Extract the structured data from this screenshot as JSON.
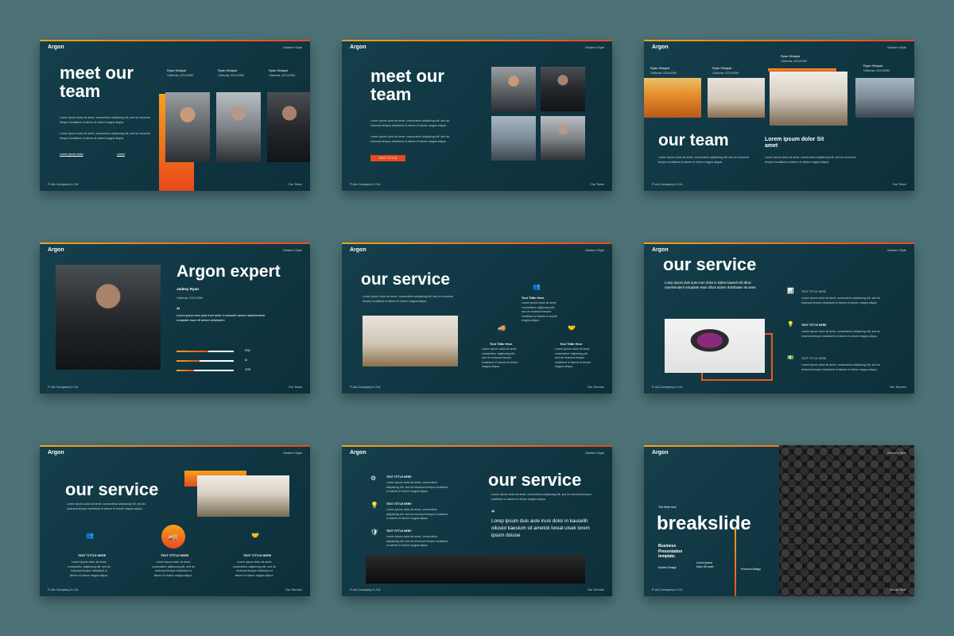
{
  "brand": "Argon",
  "style_label": "Modern Style",
  "footer_left": "P-AA Company in CA",
  "lorem": "Lorem ipsum dolor sit amet, consectetur adipiscing elit, sed do eiusmod tempor incididunt ut labore et dolore magna aliqua.",
  "slide1": {
    "title": "meet our team",
    "members": [
      {
        "name": "Ryan Hidayat",
        "meta": "California, 02/14/1990"
      },
      {
        "name": "Ryan Hidayat",
        "meta": "California, 02/14/1990"
      },
      {
        "name": "Ryan Hidayat",
        "meta": "California, 02/14/1990"
      }
    ],
    "footer_right": "Our Team",
    "link_left": "Lorem ipsum dolor",
    "link_right": "Lorem"
  },
  "slide2": {
    "title": "meet our team",
    "button": "TEXT TITTLE",
    "footer_right": "Our Team"
  },
  "slide3": {
    "title": "our team",
    "subtitle": "Lorem ipsum dolor Sit amet",
    "members": [
      {
        "name": "Ryan Hidayat",
        "meta": "California, 02/14/1990"
      },
      {
        "name": "Ryan Hidayat",
        "meta": "California, 02/14/1990"
      },
      {
        "name": "Ryan Hidayat",
        "meta": "California, 02/14/1990"
      },
      {
        "name": "Ryan Hidayat",
        "meta": "California, 02/14/1990"
      }
    ],
    "footer_right": "Our Team"
  },
  "slide4": {
    "title": "Argon expert",
    "name": "Jadesy Ryan",
    "meta": "California, 02/14/1990",
    "quote": "Lorem ipsum duis aute irure dolor in kausekh ailusci reprehenderit voluptate esse cill dolore dolorbaten",
    "skills": [
      {
        "label": "PSD",
        "value": 0.55
      },
      {
        "label": "AI",
        "value": 0.4
      },
      {
        "label": "CDR",
        "value": 0.3
      }
    ],
    "footer_right": "Our Team"
  },
  "slide5": {
    "title": "our service",
    "items": [
      {
        "label": "Text Tittle Here",
        "icon": "people-icon"
      },
      {
        "label": "Text Tittle Here",
        "icon": "truck-icon"
      },
      {
        "label": "Text Tittle Here",
        "icon": "handshake-icon"
      }
    ],
    "footer_right": "Our Service"
  },
  "slide6": {
    "title": "our service",
    "intro": "Lorep ipsum duis aute irure dolor in kalins kausell oili ollusi reprehenderit voluptate esse cillum dolore dolorbaten sit amet.",
    "items": [
      {
        "label": "TEXT TITTLE HERE",
        "icon": "chart-icon"
      },
      {
        "label": "TEXT TITTLE HERE",
        "icon": "bulb-icon"
      },
      {
        "label": "TEXT TITTLE HERE",
        "icon": "money-icon"
      }
    ],
    "footer_right": "Our Service"
  },
  "slide7": {
    "title": "our service",
    "items": [
      {
        "label": "TEXT TITTLE HERE",
        "icon": "people-icon"
      },
      {
        "label": "TEXT TITTLE HERE",
        "icon": "truck-icon"
      },
      {
        "label": "TEXT TITTLE HERE",
        "icon": "handshake-icon"
      }
    ],
    "footer_right": "Our Service"
  },
  "slide8": {
    "title": "our service",
    "items": [
      {
        "label": "TEXT TITTLE HERE",
        "icon": "gear-icon"
      },
      {
        "label": "TEXT TITTLE HERE",
        "icon": "bulb-icon"
      },
      {
        "label": "TEXT TITTLE HERE",
        "icon": "shield-icon"
      }
    ],
    "quote": "Lorep ipsum duis aute irure dolor in kauselih oilusiol kaesium sit ametok loreal uisek lorem ipsum doiuse",
    "footer_right": "Our Service"
  },
  "slide9": {
    "kicker": "Text Write here",
    "title": "breakslide",
    "sub": "Business Presentation template.",
    "label_a": "Modern Design",
    "list": "Lorem Ipsum Dolor Sit amet",
    "label_b": "Premium Design",
    "footer_right": "Break Slide"
  }
}
